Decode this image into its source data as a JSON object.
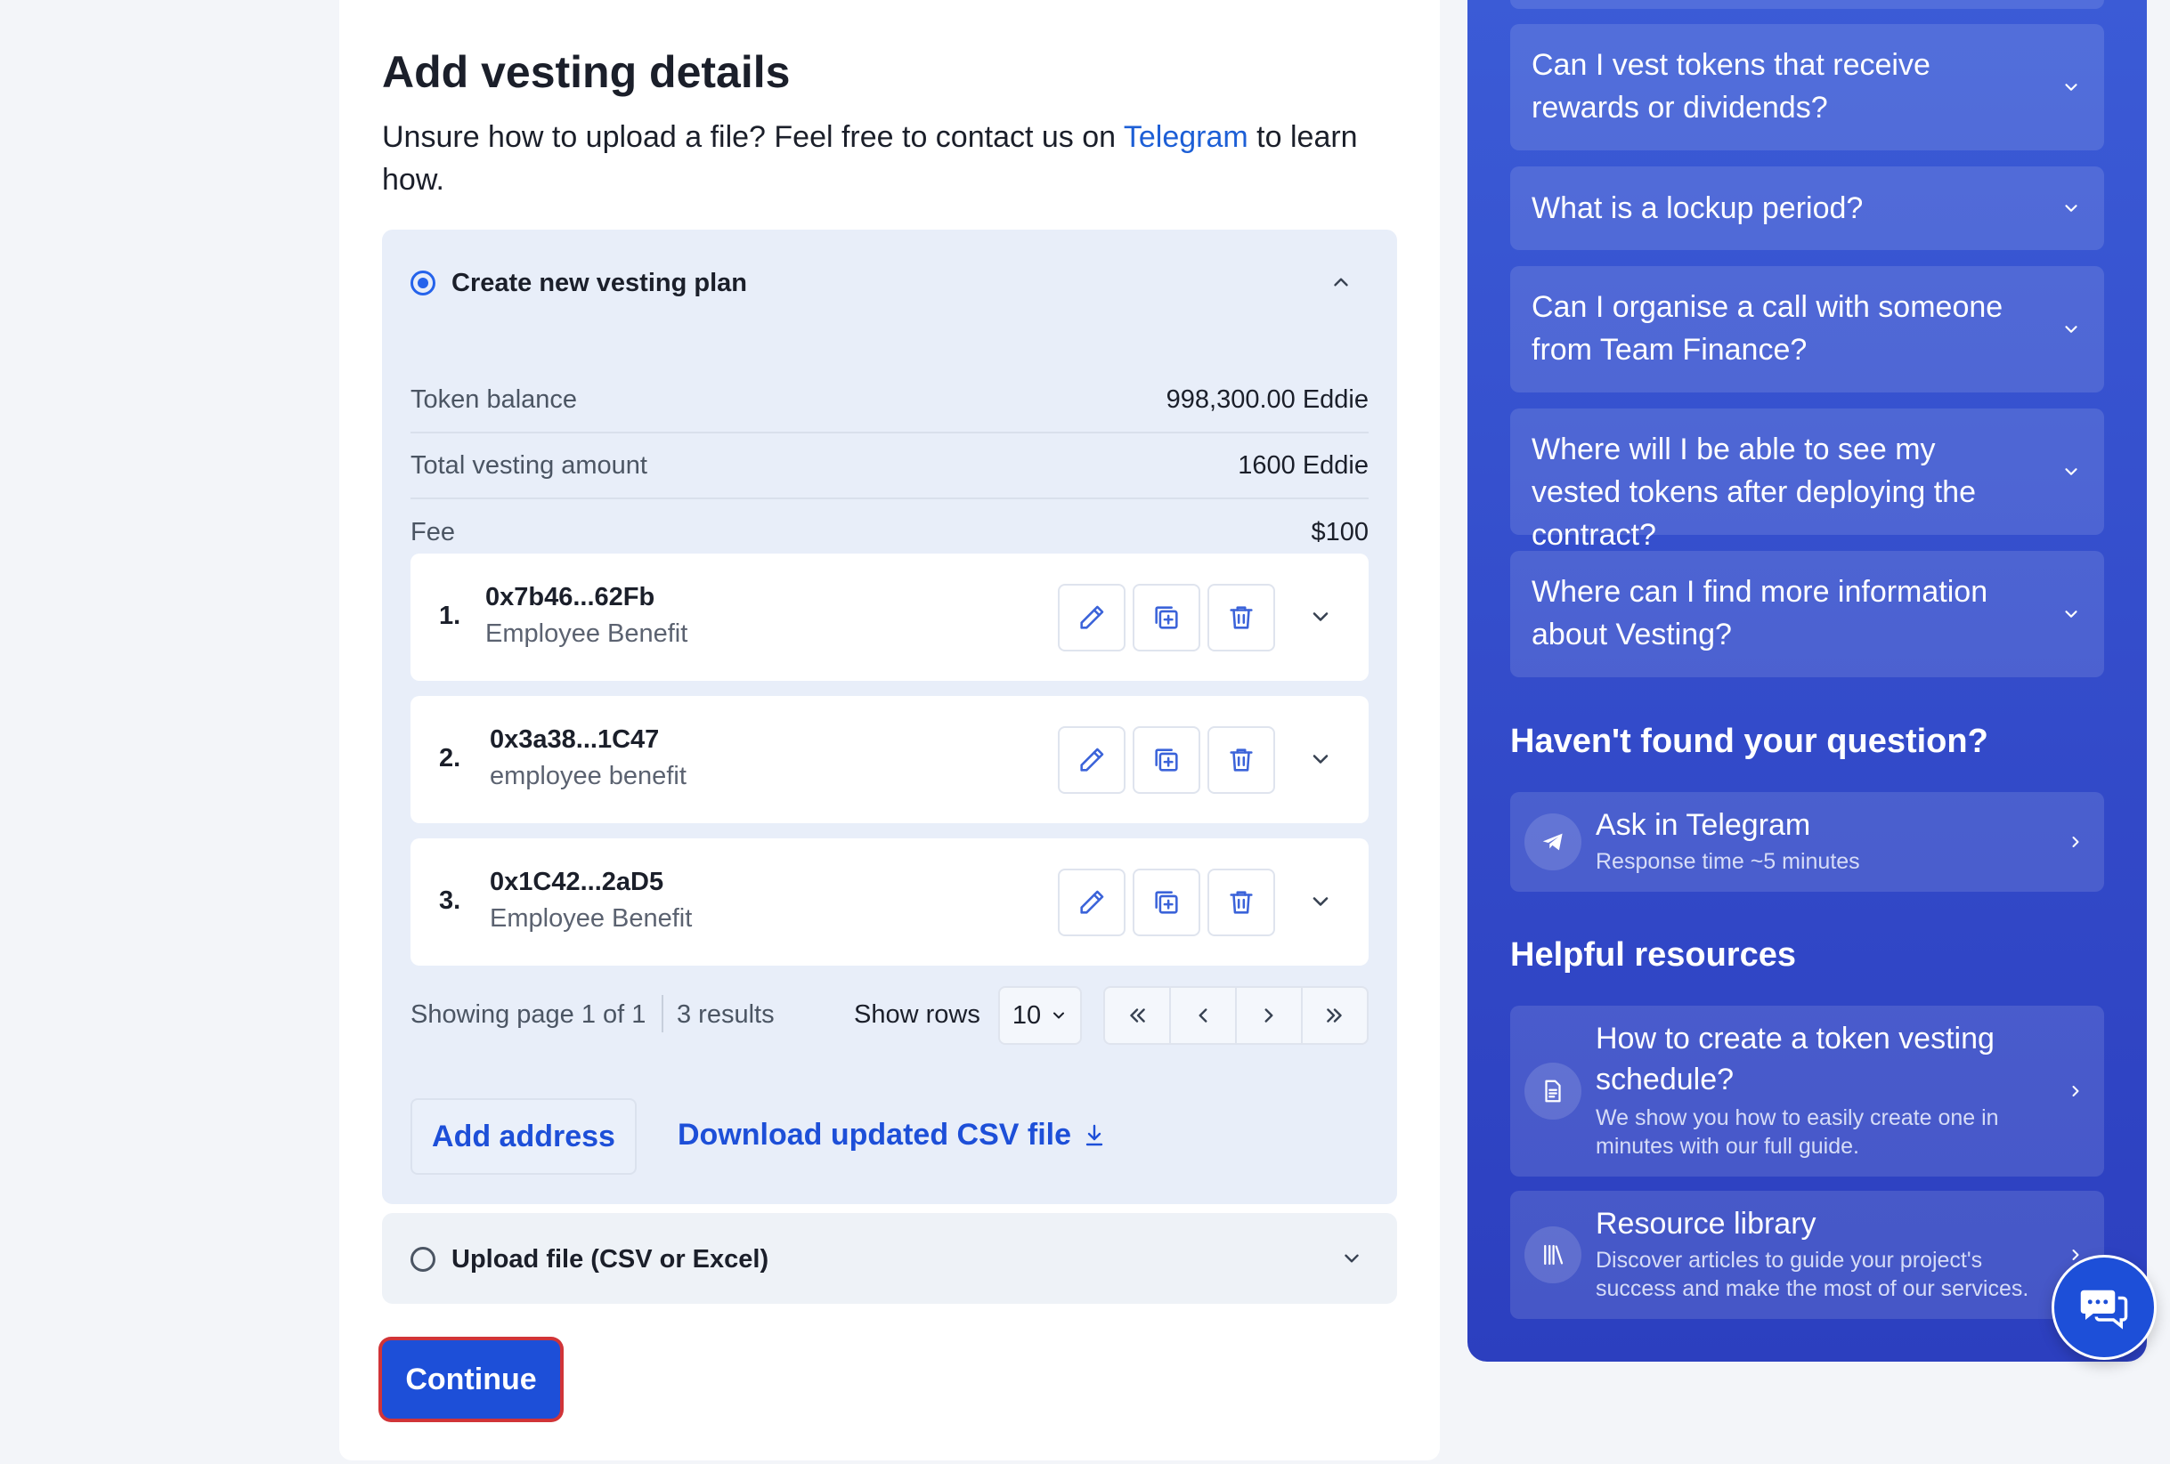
{
  "form": {
    "title": "Add vesting details",
    "subtitle_pre": "Unsure how to upload a file? Feel free to contact us on ",
    "subtitle_link": "Telegram",
    "subtitle_post": " to learn how.",
    "plan": {
      "label": "Create new vesting plan",
      "selected": true,
      "summary": [
        {
          "label": "Token balance",
          "value": "998,300.00 Eddie"
        },
        {
          "label": "Total vesting amount",
          "value": "1600 Eddie"
        },
        {
          "label": "Fee",
          "value": "$100"
        }
      ],
      "entries": [
        {
          "num": "1.",
          "address": "0x7b46...62Fb",
          "description": "Employee Benefit"
        },
        {
          "num": "2.",
          "address": "0x3a38...1C47",
          "description": "employee benefit"
        },
        {
          "num": "3.",
          "address": "0x1C42...2aD5",
          "description": "Employee Benefit"
        }
      ],
      "pagination": {
        "showing": "Showing page 1 of 1",
        "results": "3 results",
        "rows_label": "Show rows",
        "rows_value": "10"
      },
      "add_address": "Add address",
      "download_csv": "Download updated CSV file"
    },
    "upload": {
      "label": "Upload file (CSV or Excel)",
      "selected": false
    },
    "continue": "Continue"
  },
  "faq": {
    "items": [
      "Can I vest tokens that receive rewards or dividends?",
      "What is a lockup period?",
      "Can I organise a call with someone from Team Finance?",
      "Where will I be able to see my vested tokens after deploying the contract?",
      "Where can I find more information about Vesting?"
    ],
    "not_found_heading": "Haven't found your question?",
    "telegram": {
      "title": "Ask in Telegram",
      "subtitle": "Response time ~5 minutes"
    },
    "resources_heading": "Helpful resources",
    "resources": [
      {
        "title": "How to create a token vesting schedule?",
        "subtitle": "We show you how to easily create one in minutes with our full guide."
      },
      {
        "title": "Resource library",
        "subtitle": "Discover articles to guide your project's success and make the most of our services."
      }
    ]
  },
  "colors": {
    "accent": "#1d4fd8",
    "panel": "#e8eef9",
    "faq_bg": "#3249c8",
    "highlight": "#d13438"
  }
}
